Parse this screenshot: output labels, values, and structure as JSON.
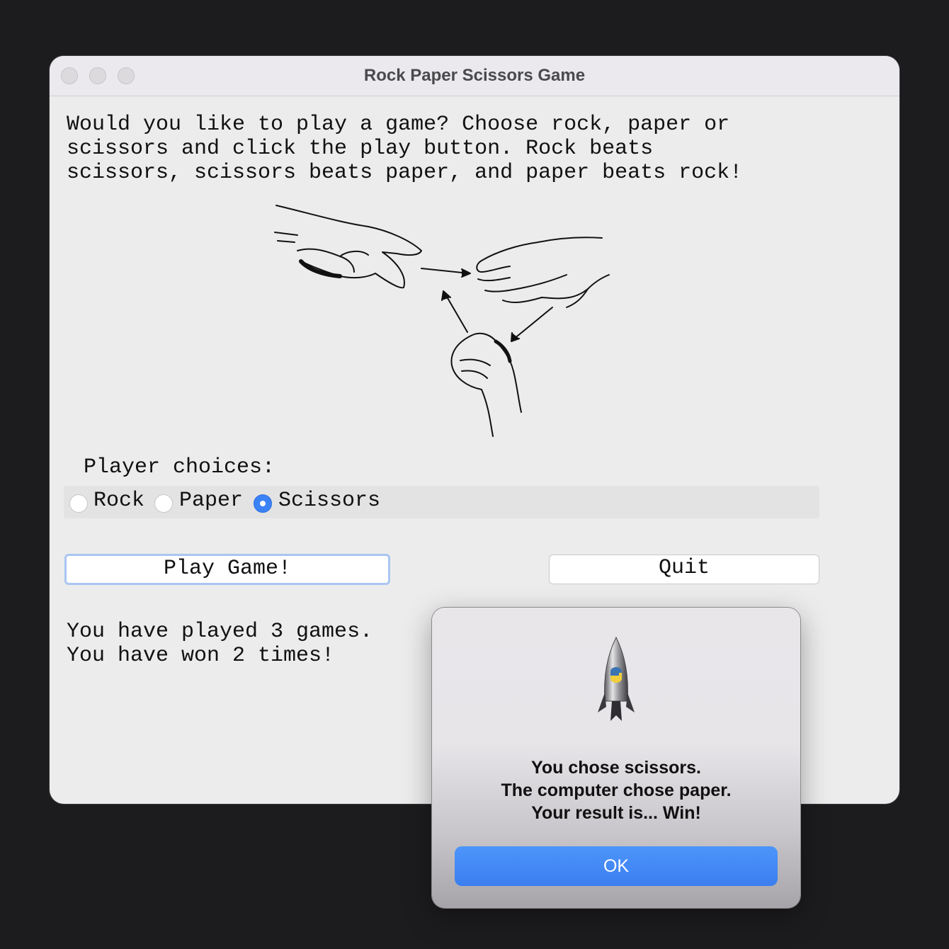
{
  "window": {
    "title": "Rock Paper Scissors Game"
  },
  "intro": {
    "line1": "Would you like to play a game? Choose rock, paper or",
    "line2": "scissors and click the play button. Rock beats",
    "line3": "scissors, scissors beats paper, and paper beats rock!"
  },
  "illustration": {
    "icon": "rock-paper-scissors-hands-illustration"
  },
  "choices": {
    "label": "Player choices:",
    "options": [
      {
        "label": "Rock",
        "selected": false
      },
      {
        "label": "Paper",
        "selected": false
      },
      {
        "label": "Scissors",
        "selected": true
      }
    ]
  },
  "buttons": {
    "play": "Play Game!",
    "quit": "Quit"
  },
  "stats": {
    "line1": "You have played 3 games.",
    "line2": "You have won 2 times!"
  },
  "dialog": {
    "icon": "python-launcher-rocket-icon",
    "line1": "You chose scissors.",
    "line2": "The computer chose paper.",
    "line3": "Your result is... Win!",
    "ok": "OK",
    "accent": "#3b82f6"
  }
}
